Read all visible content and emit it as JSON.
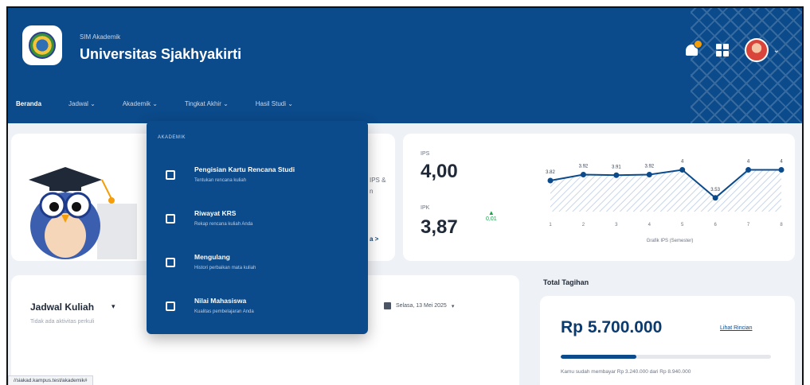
{
  "header": {
    "subtitle": "SIM Akademik",
    "title": "Universitas Sjakhyakirti"
  },
  "nav": {
    "items": [
      "Beranda",
      "Jadwal ⌄",
      "Akademik ⌄",
      "Tingkat Akhir ⌄",
      "Hasil Studi ⌄"
    ]
  },
  "welcome": {
    "text_line1": "IPS &",
    "text_line2": "n",
    "link": "a >"
  },
  "ip": {
    "ips_label": "IPS",
    "ips_value": "4,00",
    "ipk_label": "IPK",
    "ipk_value": "3,87",
    "ipk_delta": "0,01"
  },
  "chart_data": {
    "type": "line",
    "title": "",
    "xlabel": "Grafik IPS (Semester)",
    "ylabel": "",
    "categories": [
      "1",
      "2",
      "3",
      "4",
      "5",
      "6",
      "7",
      "8"
    ],
    "values": [
      3.82,
      3.92,
      3.91,
      3.92,
      4,
      3.53,
      4,
      4
    ],
    "value_labels": [
      "3.82",
      "3.92",
      "3.91",
      "3.92",
      "4",
      "3.53",
      "4",
      "4"
    ],
    "ylim": [
      3.3,
      4.1
    ],
    "grid": false,
    "color": "#0b4a8b"
  },
  "jadwal": {
    "title": "Jadwal Kuliah",
    "subtitle": "Tidak ada aktivitas perkuli",
    "date": "Selasa, 13 Mei 2025"
  },
  "tagihan": {
    "label": "Total Tagihan",
    "amount": "Rp 5.700.000",
    "link": "Lihat Rincian",
    "paid_fraction": 0.36,
    "note": "Kamu sudah membayar Rp 3.240.000 dari Rp 8.940.000"
  },
  "menu": {
    "heading": "AKADEMIK",
    "items": [
      {
        "title": "Pengisian Kartu Rencana Studi",
        "desc": "Tentukan rencana kuliah",
        "icon": "edit-icon"
      },
      {
        "title": "Riwayat KRS",
        "desc": "Rekap rencana kuliah Anda",
        "icon": "history-icon"
      },
      {
        "title": "Mengulang",
        "desc": "Histori perbaikan mata kuliah",
        "icon": "repeat-icon"
      },
      {
        "title": "Nilai Mahasiswa",
        "desc": "Kualitas pembelajaran Anda",
        "icon": "grade-icon"
      }
    ]
  },
  "status_url": "//siakad.kampus.test/akademik#"
}
